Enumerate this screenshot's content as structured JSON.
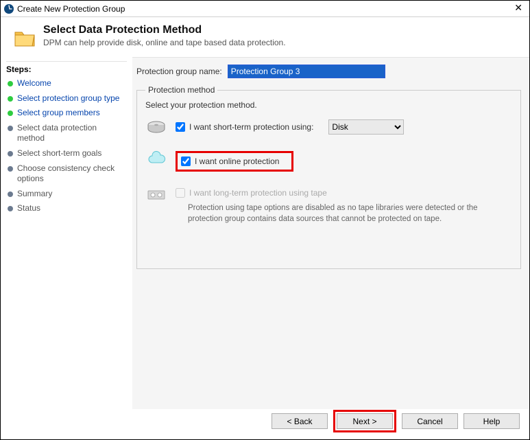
{
  "window": {
    "title": "Create New Protection Group"
  },
  "header": {
    "title": "Select Data Protection Method",
    "subtitle": "DPM can help provide disk, online and tape based data protection."
  },
  "sidebar": {
    "title": "Steps:",
    "items": [
      {
        "label": "Welcome",
        "state": "done",
        "link": true
      },
      {
        "label": "Select protection group type",
        "state": "done",
        "link": true
      },
      {
        "label": "Select group members",
        "state": "done",
        "link": true
      },
      {
        "label": "Select data protection method",
        "state": "pending",
        "link": false
      },
      {
        "label": "Select short-term goals",
        "state": "pending",
        "link": false
      },
      {
        "label": "Choose consistency check options",
        "state": "pending",
        "link": false
      },
      {
        "label": "Summary",
        "state": "pending",
        "link": false
      },
      {
        "label": "Status",
        "state": "pending",
        "link": false
      }
    ]
  },
  "form": {
    "group_name_label": "Protection group name:",
    "group_name_value": "Protection Group 3",
    "method_legend": "Protection method",
    "method_instruction": "Select your protection method.",
    "short_term_label": "I want short-term protection using:",
    "short_term_checked": true,
    "disk_option": "Disk",
    "online_label": "I want online protection",
    "online_checked": true,
    "tape_label": "I want long-term protection using tape",
    "tape_checked": false,
    "tape_desc": "Protection using tape options are disabled as no tape libraries were detected or the protection group contains data sources that cannot be protected on tape."
  },
  "footer": {
    "back": "< Back",
    "next": "Next >",
    "cancel": "Cancel",
    "help": "Help"
  }
}
